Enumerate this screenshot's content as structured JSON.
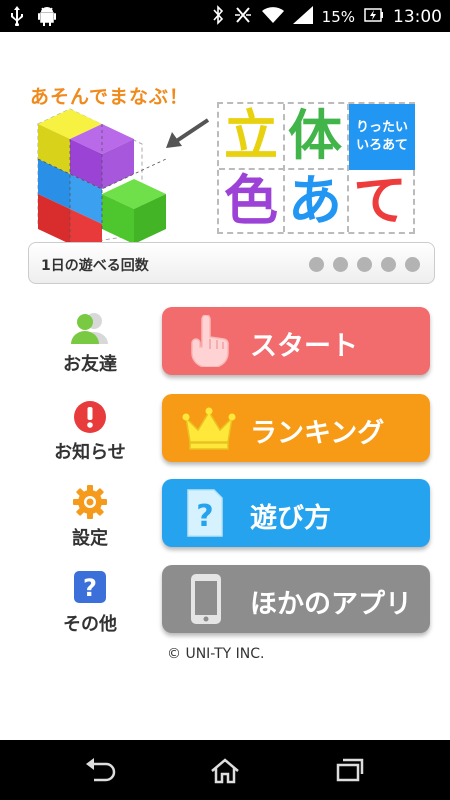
{
  "status_bar": {
    "battery_percent": "15%",
    "time": "13:00",
    "icons": [
      "usb-icon",
      "android-icon",
      "bluetooth-icon",
      "mute-icon",
      "wifi-icon",
      "signal-icon",
      "battery-charging-icon"
    ]
  },
  "header": {
    "catchphrase": "あそんでまなぶ！",
    "logo": {
      "chars": [
        "立",
        "体",
        "色",
        "あ",
        "て"
      ],
      "ruby_line1": "りったい",
      "ruby_line2": "いろあて",
      "colors": {
        "立": "#e8d20f",
        "体": "#41b54a",
        "色": "#9c42d6",
        "あ": "#2196f3",
        "て": "#ee3b3b"
      }
    }
  },
  "plays": {
    "label": "1日の遊べる回数",
    "remaining": 0,
    "total": 5
  },
  "side_menu": [
    {
      "label": "お友達",
      "icon": "friends-icon"
    },
    {
      "label": "お知らせ",
      "icon": "notice-icon"
    },
    {
      "label": "設定",
      "icon": "gear-icon"
    },
    {
      "label": "その他",
      "icon": "question-icon"
    }
  ],
  "main_buttons": [
    {
      "label": "スタート",
      "icon": "pointing-hand-icon",
      "color": "#f26b6d"
    },
    {
      "label": "ランキング",
      "icon": "crown-icon",
      "color": "#f79a16"
    },
    {
      "label": "遊び方",
      "icon": "help-document-icon",
      "color": "#26a3ee"
    },
    {
      "label": "ほかのアプリ",
      "icon": "smartphone-icon",
      "color": "#8d8d8d"
    }
  ],
  "footer": {
    "copyright": "© UNI-TY INC."
  },
  "nav_bar": {
    "buttons": [
      "back-icon",
      "home-icon",
      "recent-apps-icon"
    ]
  }
}
